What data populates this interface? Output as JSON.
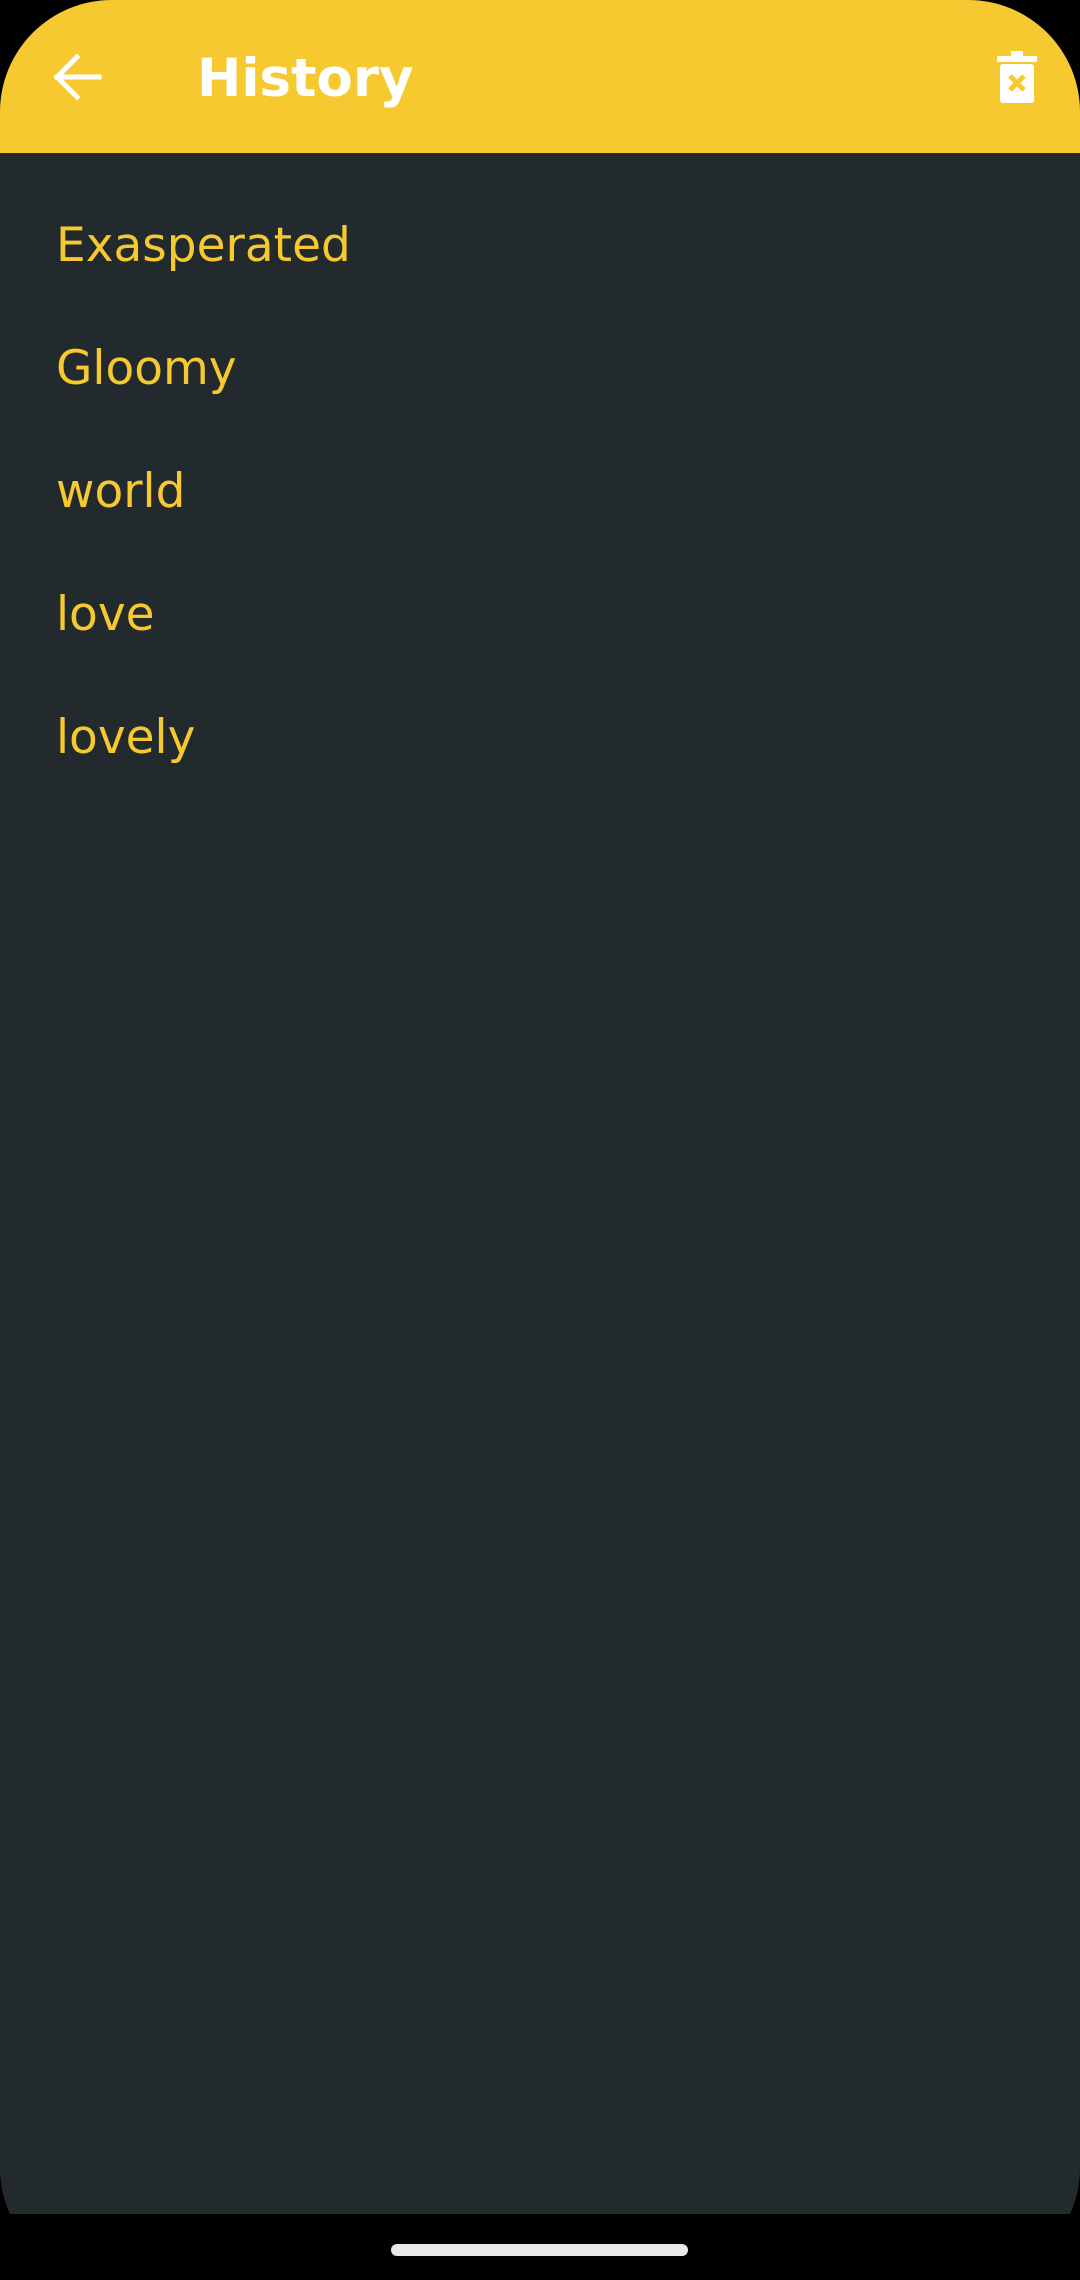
{
  "app_bar": {
    "title": "History",
    "back_icon": "arrow-left-icon",
    "delete_icon": "trash-x-icon"
  },
  "history": {
    "items": [
      {
        "label": "Exasperated"
      },
      {
        "label": "Gloomy"
      },
      {
        "label": "world"
      },
      {
        "label": "love"
      },
      {
        "label": "lovely"
      }
    ]
  },
  "colors": {
    "accent": "#f6c930",
    "background": "#232a2d",
    "title_text": "#ffffff",
    "item_text": "#f6c930"
  }
}
